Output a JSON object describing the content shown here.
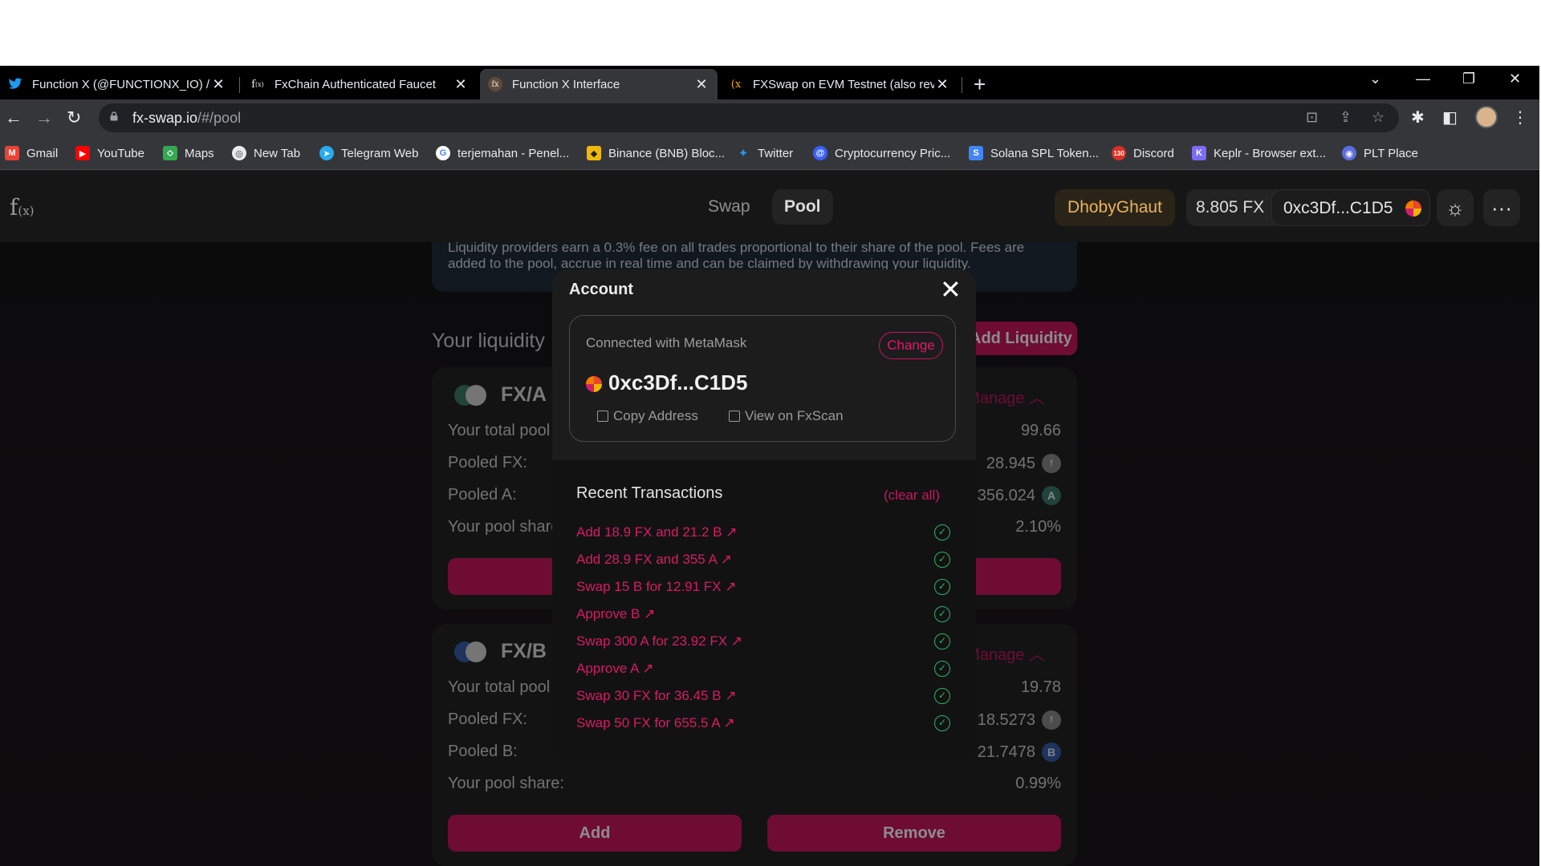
{
  "browser": {
    "tabs": [
      {
        "title": "Function X (@FUNCTIONX_IO) /",
        "icon": "twitter-bird",
        "active": false
      },
      {
        "title": "FxChain Authenticated Faucet",
        "icon": "fx-logo",
        "active": false
      },
      {
        "title": "Function X Interface",
        "icon": "fx-logo",
        "active": true
      },
      {
        "title": "FXSwap on EVM Testnet (also rev",
        "icon": "fx-logo",
        "active": false
      }
    ],
    "new_tab": "+",
    "url_host": "fx-swap.io",
    "url_path": "/#/pool",
    "bookmarks": [
      {
        "label": "Gmail",
        "color": "#ea4335"
      },
      {
        "label": "YouTube",
        "color": "#ff0000"
      },
      {
        "label": "Maps",
        "color": "#34a853"
      },
      {
        "label": "New Tab",
        "color": "#9aa0a6"
      },
      {
        "label": "Telegram Web",
        "color": "#2aabee"
      },
      {
        "label": "terjemahan - Penel...",
        "color": "#4285f4"
      },
      {
        "label": "Binance (BNB) Bloc...",
        "color": "#f0b90b"
      },
      {
        "label": "Twitter",
        "color": "#1d9bf0"
      },
      {
        "label": "Cryptocurrency Pric...",
        "color": "#3861fb"
      },
      {
        "label": "Solana SPL Token...",
        "color": "#4285f4"
      },
      {
        "label": "Discord",
        "color": "#d93025"
      },
      {
        "label": "Keplr - Browser ext...",
        "color": "#7b6cf6"
      },
      {
        "label": "PLT Place",
        "color": "#5b6ee1"
      }
    ]
  },
  "app": {
    "nav": {
      "swap": "Swap",
      "pool": "Pool"
    },
    "network_name": "DhobyGhaut",
    "balance": "8.805 FX",
    "wallet_address": "0xc3Df...C1D5",
    "accent_color": "#c8165e",
    "info_text": "Liquidity providers earn a 0.3% fee on all trades proportional to their share of the pool. Fees are added to the pool, accrue in real time and can be claimed by withdrawing your liquidity.",
    "your_liquidity": "Your liquidity",
    "add_liquidity": "Add Liquidity",
    "pools": [
      {
        "name": "FX/A",
        "manage": "Manage",
        "total_label": "Your total pool tokens:",
        "total_value": "99.66",
        "pooled_fx_label": "Pooled FX:",
        "pooled_fx_value": "28.945",
        "pooled_tok_label": "Pooled A:",
        "pooled_tok_value": "356.024",
        "share_label": "Your pool share:",
        "share_value": "2.10%"
      },
      {
        "name": "FX/B",
        "manage": "Manage",
        "total_label": "Your total pool tokens:",
        "total_value": "19.78",
        "pooled_fx_label": "Pooled FX:",
        "pooled_fx_value": "18.5273",
        "pooled_tok_label": "Pooled B:",
        "pooled_tok_value": "21.7478",
        "share_label": "Your pool share:",
        "share_value": "0.99%",
        "add": "Add",
        "remove": "Remove"
      }
    ]
  },
  "modal": {
    "title": "Account",
    "connected_with": "Connected with MetaMask",
    "change": "Change",
    "address": "0xc3Df...C1D5",
    "copy_address": "Copy Address",
    "view_on_scan": "View on FxScan",
    "recent_title": "Recent Transactions",
    "clear_all": "(clear all)",
    "transactions": [
      "Add 18.9 FX and 21.2 B ↗",
      "Add 28.9 FX and 355 A ↗",
      "Swap 15 B for 12.91 FX ↗",
      "Approve B ↗",
      "Swap 300 A for 23.92 FX ↗",
      "Approve A ↗",
      "Swap 30 FX for 36.45 B ↗",
      "Swap 50 FX for 655.5 A ↗"
    ]
  }
}
